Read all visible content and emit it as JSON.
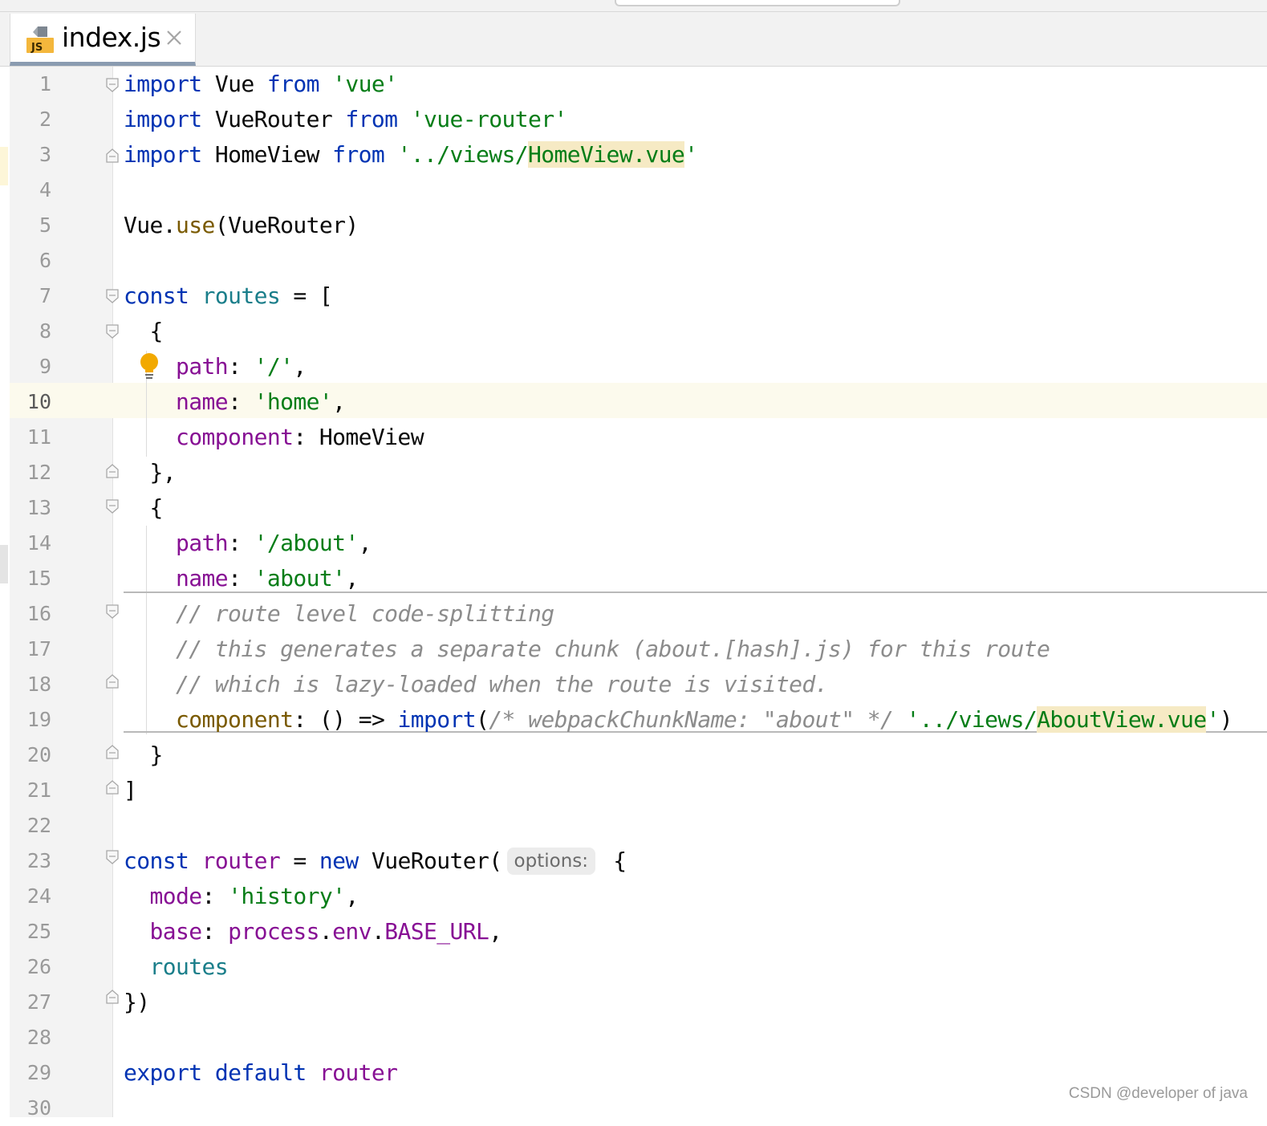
{
  "tab": {
    "icon": "js-file-icon",
    "icon_badge": "JS",
    "label": "index.js",
    "close_icon": "close-icon"
  },
  "editor": {
    "current_line": 10,
    "line_numbers": [
      "1",
      "2",
      "3",
      "4",
      "5",
      "6",
      "7",
      "8",
      "9",
      "10",
      "11",
      "12",
      "13",
      "14",
      "15",
      "16",
      "17",
      "18",
      "19",
      "20",
      "21",
      "22",
      "23",
      "24",
      "25",
      "26",
      "27",
      "28",
      "29",
      "30"
    ],
    "lines": [
      "import Vue from 'vue'",
      "import VueRouter from 'vue-router'",
      "import HomeView from '../views/HomeView.vue'",
      "",
      "Vue.use(VueRouter)",
      "",
      "const routes = [",
      "  {",
      "    path: '/',",
      "    name: 'home',",
      "    component: HomeView",
      "  },",
      "  {",
      "    path: '/about',",
      "    name: 'about',",
      "    // route level code-splitting",
      "    // this generates a separate chunk (about.[hash].js) for this route",
      "    // which is lazy-loaded when the route is visited.",
      "    component: () => import(/* webpackChunkName: \"about\" */ '../views/AboutView.vue')",
      "  }",
      "]",
      "",
      "const router = new VueRouter(options: {",
      "  mode: 'history',",
      "  base: process.env.BASE_URL,",
      "  routes",
      "})",
      "",
      "export default router",
      ""
    ],
    "inlay_hint": "options:",
    "intention_icon": "lightbulb-icon"
  },
  "watermark": "CSDN @developer of java",
  "colors": {
    "keyword": "#0033b3",
    "string": "#067d17",
    "property": "#871094",
    "variable": "#1a7e8a",
    "comment": "#8c8c8c",
    "highlight": "#f6eac4",
    "current_line": "#fcfaed"
  }
}
